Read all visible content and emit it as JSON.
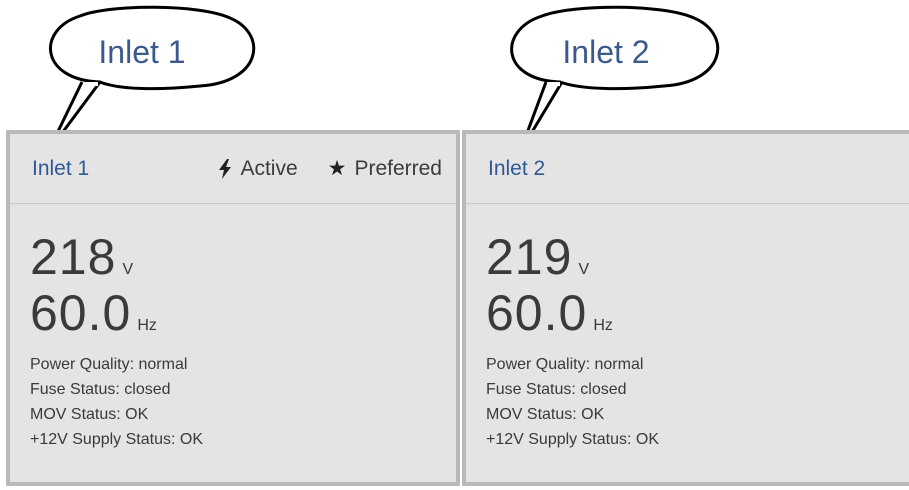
{
  "callouts": [
    {
      "label": "Inlet 1"
    },
    {
      "label": "Inlet 2"
    }
  ],
  "panels": [
    {
      "name": "Inlet 1",
      "active_label": "Active",
      "preferred_label": "Preferred",
      "voltage": {
        "value": "218",
        "unit": "V"
      },
      "frequency": {
        "value": "60.0",
        "unit": "Hz"
      },
      "status": [
        "Power Quality: normal",
        "Fuse Status: closed",
        "MOV Status: OK",
        "+12V Supply Status: OK"
      ]
    },
    {
      "name": "Inlet 2",
      "voltage": {
        "value": "219",
        "unit": "V"
      },
      "frequency": {
        "value": "60.0",
        "unit": "Hz"
      },
      "status": [
        "Power Quality: normal",
        "Fuse Status: closed",
        "MOV Status: OK",
        "+12V Supply Status: OK"
      ]
    }
  ],
  "icons": {
    "active": "bolt-icon",
    "preferred": "star-icon"
  },
  "colors": {
    "panel_bg": "#e4e4e4",
    "panel_border": "#b9b9b9",
    "inlet_name": "#2e5896",
    "callout_text": "#3a5a8c"
  }
}
